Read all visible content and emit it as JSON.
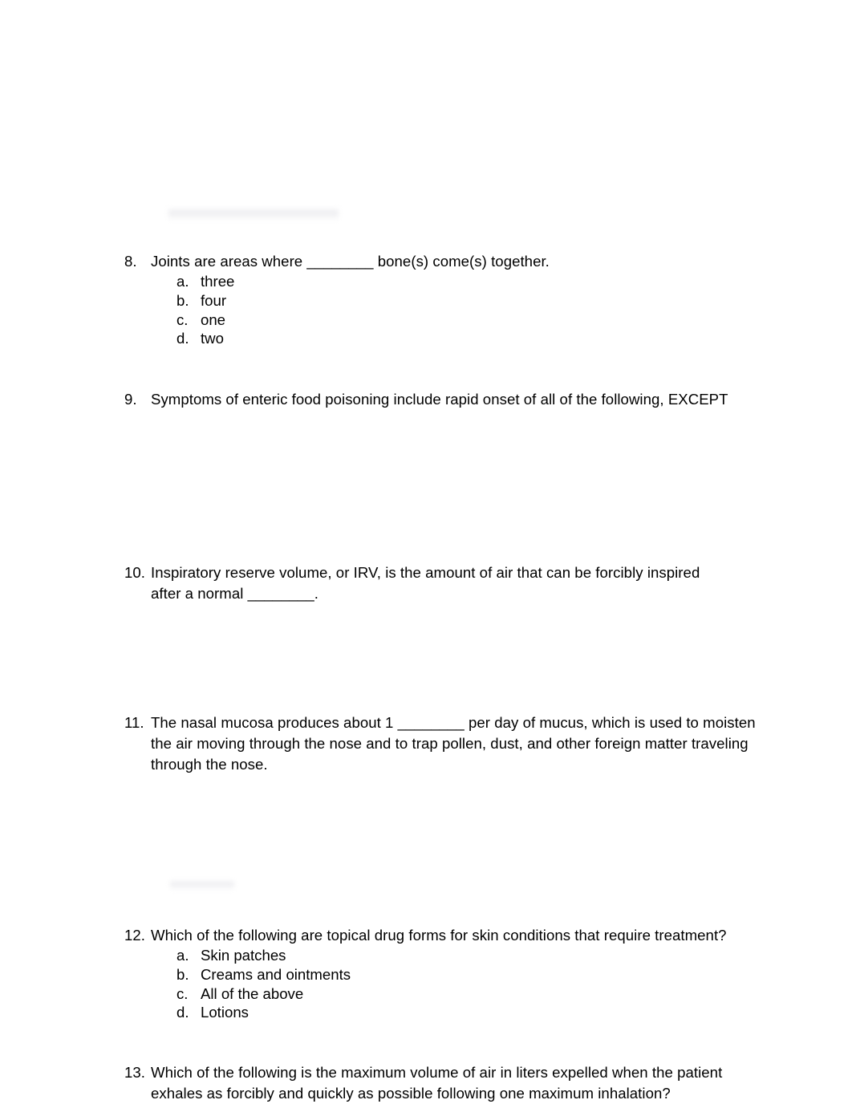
{
  "document": {
    "page_background": "#ffffff",
    "text_color": "#000000",
    "artifacts": [
      {
        "name": "blurred-redaction-top",
        "note": "faint grey blurred remnant above question 8"
      },
      {
        "name": "blurred-redaction-middle",
        "note": "faint grey blurred remnant above question 12"
      }
    ]
  },
  "questions": [
    {
      "number": "8.",
      "text": "Joints are areas where ________ bone(s) come(s) together.",
      "options": [
        {
          "letter": "a.",
          "text": "three"
        },
        {
          "letter": "b.",
          "text": "four"
        },
        {
          "letter": "c.",
          "text": "one"
        },
        {
          "letter": "d.",
          "text": "two"
        }
      ]
    },
    {
      "number": "9.",
      "text": "Symptoms of enteric food poisoning include rapid onset of all of the following, EXCEPT",
      "options": []
    },
    {
      "number": "10.",
      "text": "Inspiratory reserve volume, or IRV, is the amount of air that can be forcibly inspired after a normal ________.",
      "options": []
    },
    {
      "number": "11.",
      "text": "The nasal mucosa produces about 1 ________ per day of mucus, which is used to moisten the air moving through the nose and to trap pollen, dust, and other foreign matter traveling through the nose.",
      "options": []
    },
    {
      "number": "12.",
      "text": "Which of the following are topical drug forms for skin conditions that require treatment?",
      "options": [
        {
          "letter": "a.",
          "text": "Skin patches"
        },
        {
          "letter": "b.",
          "text": "Creams and ointments"
        },
        {
          "letter": "c.",
          "text": "All of the above"
        },
        {
          "letter": "d.",
          "text": "Lotions"
        }
      ]
    },
    {
      "number": "13.",
      "text": "Which of the following is the maximum volume of air in liters expelled when the patient exhales as forcibly and quickly as possible following one maximum inhalation?",
      "options": []
    }
  ]
}
